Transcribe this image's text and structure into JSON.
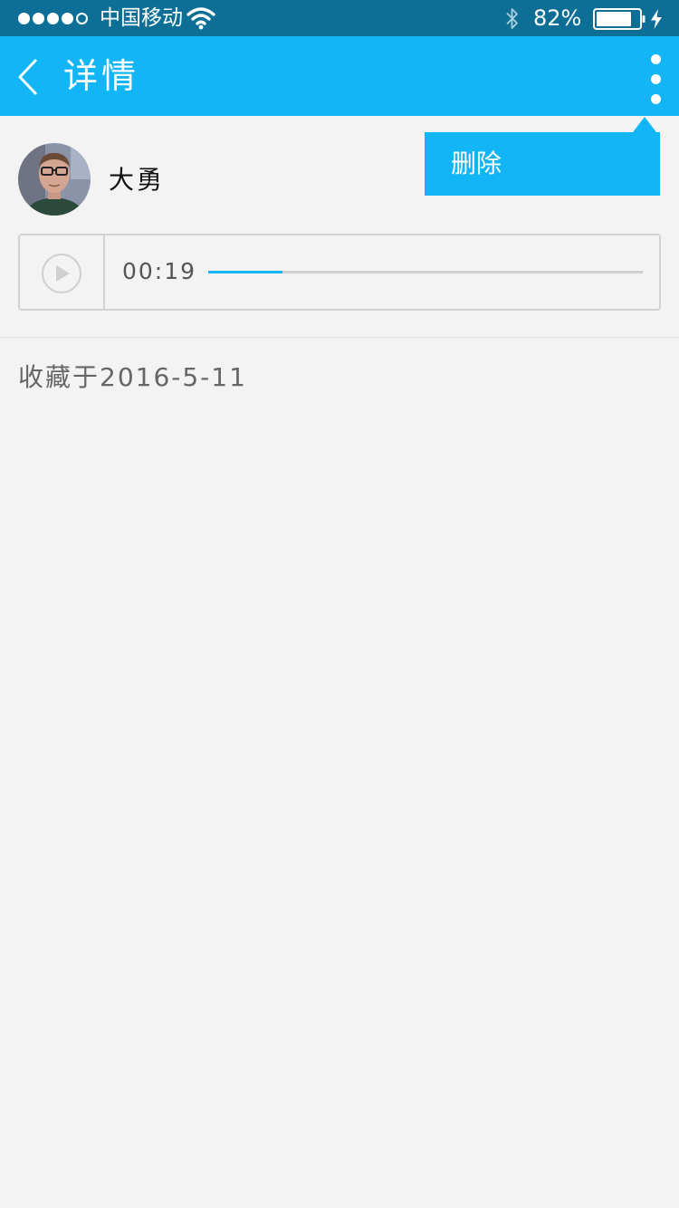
{
  "status_bar": {
    "signal_filled": 4,
    "signal_total": 5,
    "carrier": "中国移动",
    "battery_percent": "82%",
    "battery_level": 0.82,
    "icons": [
      "wifi-icon",
      "bluetooth-icon",
      "battery-icon",
      "charging-icon"
    ]
  },
  "nav": {
    "back_icon": "chevron-left-icon",
    "title": "详情",
    "more_icon": "vertical-ellipsis-icon"
  },
  "popup_menu": {
    "items": [
      {
        "label": "删除"
      }
    ]
  },
  "item": {
    "author_name": "大勇",
    "voice": {
      "play_icon": "play-icon",
      "duration": "00:19",
      "progress": 0.17
    },
    "saved_text": "收藏于2016-5-11"
  },
  "colors": {
    "accent": "#12b5f5",
    "status_bar_bg": "#0e6f96",
    "page_bg": "#f3f3f3",
    "border": "#d2d2d2"
  }
}
